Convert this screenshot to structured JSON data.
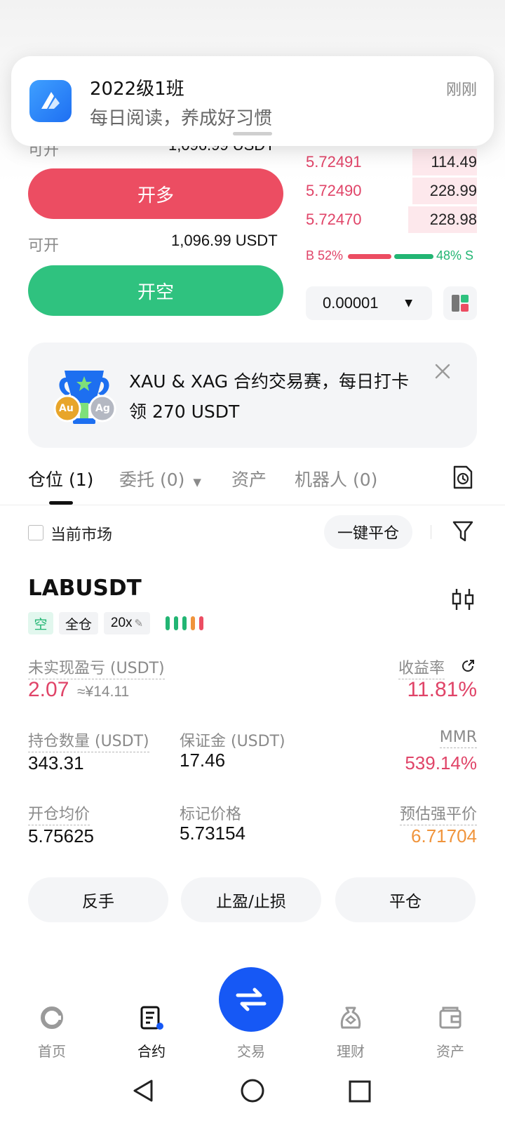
{
  "notification": {
    "title": "2022级1班",
    "message": "每日阅读，养成好习惯",
    "time": "刚刚"
  },
  "order_form": {
    "available_label_top": "可开",
    "available_value_top": "1,096.99 USDT",
    "open_long_label": "开多",
    "available_label": "可开",
    "available_value": "1,096.99 USDT",
    "open_short_label": "开空"
  },
  "orderbook": {
    "rows": [
      {
        "price": "5.72491",
        "qty": "114.49",
        "depth": 0.38
      },
      {
        "price": "5.72490",
        "qty": "228.99",
        "depth": 0.38
      },
      {
        "price": "5.72470",
        "qty": "228.98",
        "depth": 0.4
      }
    ],
    "buy_ratio_label": "B 52%",
    "sell_ratio_label": "48% S",
    "buy_ratio": 52,
    "sell_ratio": 48,
    "precision_value": "0.00001"
  },
  "banner": {
    "text": "XAU & XAG 合约交易赛，每日打卡领 270 USDT",
    "badge_left": "Au",
    "badge_right": "Ag"
  },
  "tabs": {
    "positions": "仓位 (1)",
    "orders": "委托 (0)",
    "assets": "资产",
    "bots": "机器人 (0)"
  },
  "filters": {
    "current_market": "当前市场",
    "close_all": "一键平仓"
  },
  "position": {
    "symbol": "LABUSDT",
    "side_tag": "空",
    "margin_mode_tag": "全仓",
    "leverage_tag": "20x",
    "unrealized_pnl_label": "未实现盈亏 (USDT)",
    "unrealized_pnl": "2.07",
    "unrealized_pnl_cny": "≈¥14.11",
    "roe_label": "收益率",
    "roe": "11.81%",
    "size_label": "持仓数量 (USDT)",
    "size": "343.31",
    "margin_label": "保证金 (USDT)",
    "margin": "17.46",
    "mmr_label": "MMR",
    "mmr": "539.14%",
    "entry_label": "开仓均价",
    "entry": "5.75625",
    "mark_label": "标记价格",
    "mark": "5.73154",
    "liq_label": "预估强平价",
    "liq": "6.71704"
  },
  "actions": {
    "reverse": "反手",
    "tp_sl": "止盈/止损",
    "close": "平仓"
  },
  "bottom_nav": {
    "home": "首页",
    "futures": "合约",
    "trade": "交易",
    "earn": "理财",
    "assets": "资产"
  },
  "colors": {
    "red": "#e04468",
    "green": "#22b573",
    "orange": "#f0943c",
    "blue": "#1658f5"
  }
}
